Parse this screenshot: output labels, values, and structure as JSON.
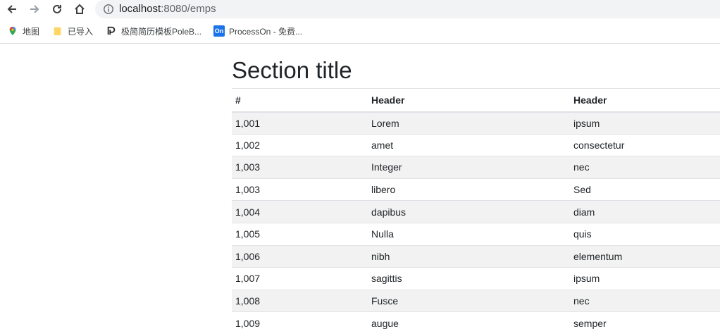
{
  "browser": {
    "url_host": "localhost",
    "url_rest": ":8080/emps"
  },
  "bookmarks": [
    {
      "label": "地图",
      "icon": "maps-pin-icon"
    },
    {
      "label": "已导入",
      "icon": "folder-icon"
    },
    {
      "label": "极简简历模板PoleB...",
      "icon": "poleb-icon"
    },
    {
      "label": "ProcessOn - 免费...",
      "icon": "processon-icon",
      "badge": "On"
    }
  ],
  "main": {
    "title": "Section title",
    "table": {
      "headers": [
        "#",
        "Header",
        "Header"
      ],
      "rows": [
        [
          "1,001",
          "Lorem",
          "ipsum"
        ],
        [
          "1,002",
          "amet",
          "consectetur"
        ],
        [
          "1,003",
          "Integer",
          "nec"
        ],
        [
          "1,003",
          "libero",
          "Sed"
        ],
        [
          "1,004",
          "dapibus",
          "diam"
        ],
        [
          "1,005",
          "Nulla",
          "quis"
        ],
        [
          "1,006",
          "nibh",
          "elementum"
        ],
        [
          "1,007",
          "sagittis",
          "ipsum"
        ],
        [
          "1,008",
          "Fusce",
          "nec"
        ],
        [
          "1,009",
          "augue",
          "semper"
        ]
      ]
    }
  },
  "colors": {
    "stripe": "#f2f2f2",
    "border": "#dee2e6",
    "text": "#212529"
  }
}
